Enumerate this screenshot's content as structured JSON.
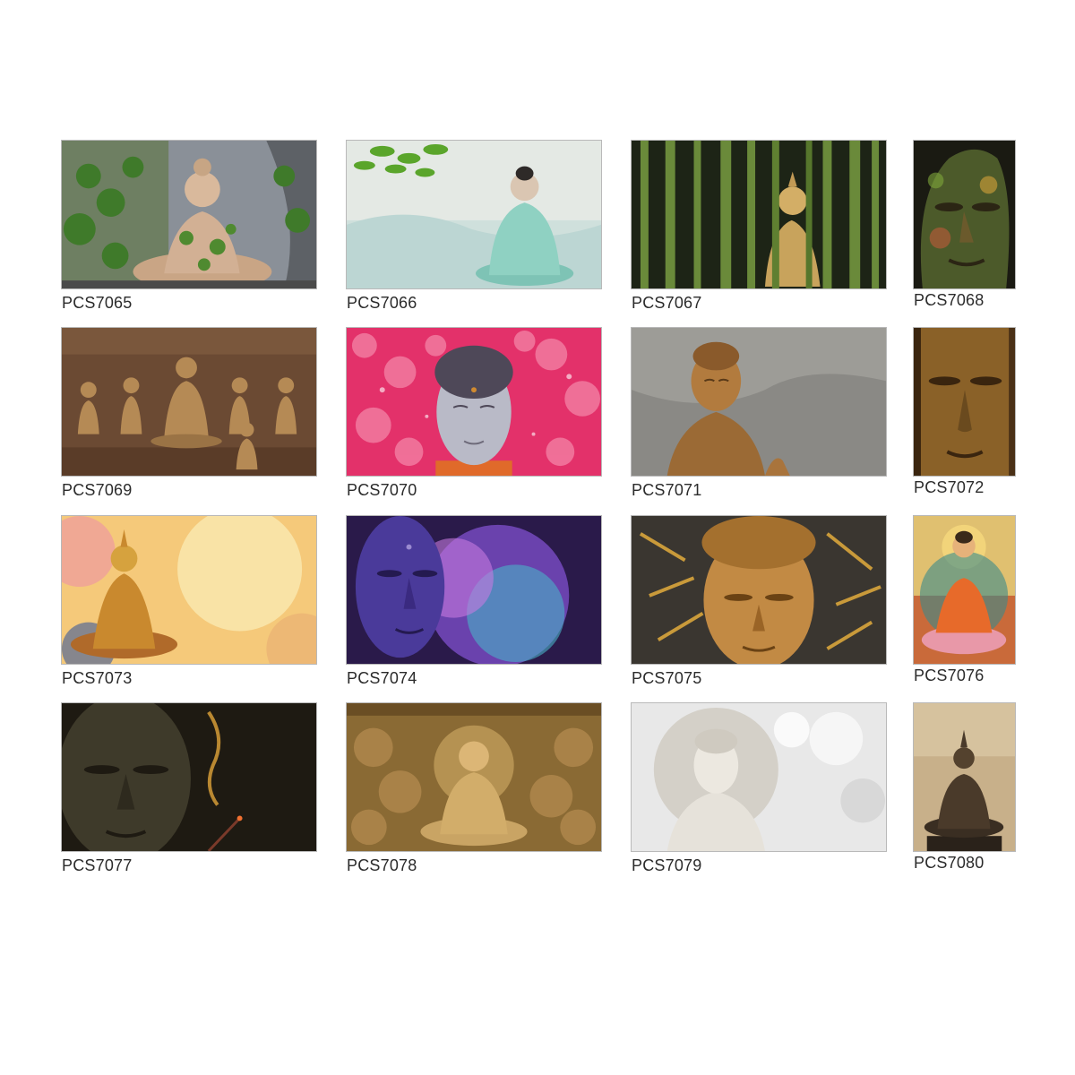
{
  "catalog": {
    "items": [
      {
        "code": "PCS7065",
        "scene": "seated-buddha-with-vines"
      },
      {
        "code": "PCS7066",
        "scene": "mint-buddha-under-leaves"
      },
      {
        "code": "PCS7067",
        "scene": "buddha-in-bamboo-grove"
      },
      {
        "code": "PCS7068",
        "scene": "colorful-buddha-face"
      },
      {
        "code": "PCS7069",
        "scene": "bronze-relief-disciples"
      },
      {
        "code": "PCS7070",
        "scene": "buddha-head-pink-blossoms"
      },
      {
        "code": "PCS7071",
        "scene": "wooden-buddha-statue"
      },
      {
        "code": "PCS7072",
        "scene": "golden-buddha-face-closeup"
      },
      {
        "code": "PCS7073",
        "scene": "golden-buddha-watercolor"
      },
      {
        "code": "PCS7074",
        "scene": "violet-buddha-face-glow"
      },
      {
        "code": "PCS7075",
        "scene": "golden-buddha-face-leaves"
      },
      {
        "code": "PCS7076",
        "scene": "buddha-on-lotus-painting"
      },
      {
        "code": "PCS7077",
        "scene": "dark-buddha-face-incense"
      },
      {
        "code": "PCS7078",
        "scene": "carved-buddha-relief"
      },
      {
        "code": "PCS7079",
        "scene": "white-stone-buddha"
      },
      {
        "code": "PCS7080",
        "scene": "bronze-buddha-statue"
      }
    ]
  }
}
